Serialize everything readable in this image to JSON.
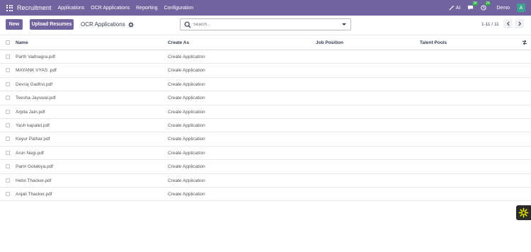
{
  "navbar": {
    "app_name": "Recruitment",
    "menu": [
      "Applications",
      "OCR Applications",
      "Reporting",
      "Configuration"
    ],
    "ai_label": "AI",
    "messages_count": "26",
    "activities_count": "24",
    "company": "Demo",
    "avatar_letter": "A",
    "bg_color": "#71639e"
  },
  "control": {
    "new_label": "New",
    "upload_label": "Upload Resumes",
    "title": "OCR Applications",
    "search_placeholder": "Search...",
    "pager": "1-11 / 11"
  },
  "table": {
    "columns": [
      "Name",
      "Create As",
      "Job Position",
      "Talent Pools"
    ],
    "rows": [
      {
        "name": "Parth Vadnagra.pdf",
        "create_as": "Create Application",
        "job_position": "",
        "talent_pools": ""
      },
      {
        "name": "MAYANK VYAS .pdf",
        "create_as": "Create Application",
        "job_position": "",
        "talent_pools": ""
      },
      {
        "name": "Devraj Gadhvi.pdf",
        "create_as": "Create Application",
        "job_position": "",
        "talent_pools": ""
      },
      {
        "name": "Teesha Jayswal.pdf",
        "create_as": "Create Application",
        "job_position": "",
        "talent_pools": ""
      },
      {
        "name": "Arpita Jain.pdf",
        "create_as": "Create Application",
        "job_position": "",
        "talent_pools": ""
      },
      {
        "name": "Yash kapatel.pdf",
        "create_as": "Create Application",
        "job_position": "",
        "talent_pools": ""
      },
      {
        "name": "Keyur Pathar.pdf",
        "create_as": "Create Application",
        "job_position": "",
        "talent_pools": ""
      },
      {
        "name": "Arun Negi.pdf",
        "create_as": "Create Application",
        "job_position": "",
        "talent_pools": ""
      },
      {
        "name": "Parin Golakiya.pdf",
        "create_as": "Create Application",
        "job_position": "",
        "talent_pools": ""
      },
      {
        "name": "Hetvi Thacker.pdf",
        "create_as": "Create Application",
        "job_position": "",
        "talent_pools": ""
      },
      {
        "name": "Anjali Thacker.pdf",
        "create_as": "Create Application",
        "job_position": "",
        "talent_pools": ""
      }
    ]
  },
  "icons": [
    "apps-grid-icon",
    "ai-wand-icon",
    "messages-icon",
    "activity-clock-icon",
    "gear-icon",
    "search-icon",
    "dropdown-caret-icon",
    "chevron-left-icon",
    "chevron-right-icon",
    "optional-columns-icon",
    "sparkle-widget-icon"
  ]
}
